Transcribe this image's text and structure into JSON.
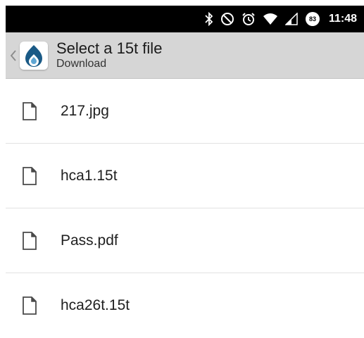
{
  "status_bar": {
    "time": "11:48",
    "battery_level": "83",
    "icons": [
      "bluetooth-icon",
      "do-not-disturb-icon",
      "alarm-icon",
      "wifi-icon",
      "cell-signal-icon",
      "battery-icon"
    ]
  },
  "action_bar": {
    "title": "Select a 15t file",
    "subtitle": "Download",
    "accent_color": "#1a5a86"
  },
  "files": [
    {
      "name": "217.jpg"
    },
    {
      "name": "hca1.15t"
    },
    {
      "name": "Pass.pdf"
    },
    {
      "name": "hca26t.15t"
    }
  ]
}
